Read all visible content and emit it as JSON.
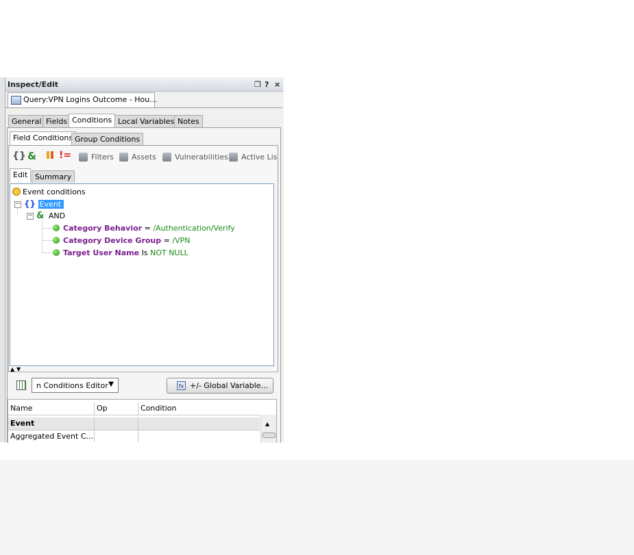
{
  "window": {
    "title": "Inspect/Edit",
    "controls": [
      "❐",
      "?",
      "×"
    ]
  },
  "document_tab": {
    "label": "Query:VPN Logins Outcome - Hou..."
  },
  "main_tabs": [
    {
      "label": "General"
    },
    {
      "label": "Fields"
    },
    {
      "label": "Conditions"
    },
    {
      "label": "Local Variables"
    },
    {
      "label": "Notes"
    }
  ],
  "sub_tabs": [
    {
      "label": "Field Conditions"
    },
    {
      "label": "Group Conditions"
    }
  ],
  "toolbar": {
    "filters": "Filters",
    "assets": "Assets",
    "vulnerabilities": "Vulnerabilities",
    "active_lists": "Active Lis"
  },
  "editor_tabs": [
    {
      "label": "Edit"
    },
    {
      "label": "Summary"
    }
  ],
  "tree": {
    "root": "Event conditions",
    "event": "Event",
    "and": "AND",
    "conditions": [
      {
        "field": "Category Behavior",
        "op": "=",
        "value": "/Authentication/Verify"
      },
      {
        "field": "Category Device Group",
        "op": "=",
        "value": "/VPN"
      },
      {
        "field": "Target User Name",
        "op": "Is",
        "value": "NOT NULL"
      }
    ]
  },
  "bottom": {
    "editor_select": "n Conditions Editor",
    "global_var_button": "+/- Global Variable..."
  },
  "grid": {
    "headers": [
      "Name",
      "Op",
      "Condition"
    ],
    "rows": [
      {
        "name": "Event",
        "op": "",
        "condition": ""
      },
      {
        "name": "Aggregated Event C...",
        "op": "",
        "condition": ""
      }
    ]
  },
  "colors": {
    "field": "#7a1f8e",
    "value": "#1a8a1a",
    "selection": "#3399ff"
  }
}
